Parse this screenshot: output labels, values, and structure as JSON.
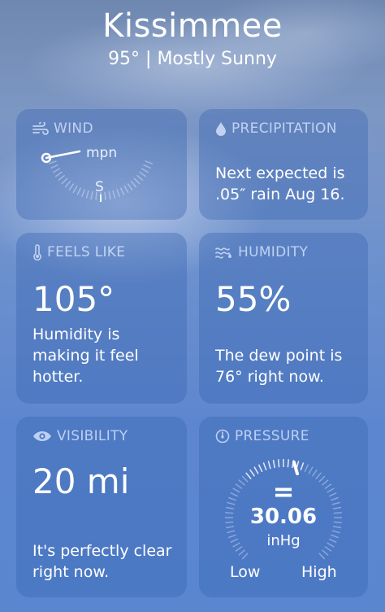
{
  "header": {
    "city": "Kissimmee",
    "summary": "95° | Mostly Sunny"
  },
  "wind": {
    "title": "WIND",
    "unit": "mpn",
    "direction": "S",
    "icon": "wind-icon"
  },
  "precipitation": {
    "title": "PRECIPITATION",
    "text": "Next expected is .05″ rain Aug 16.",
    "icon": "droplet-icon"
  },
  "feels_like": {
    "title": "FEELS LIKE",
    "value": "105°",
    "text": "Humidity is making it feel hotter.",
    "icon": "thermometer-icon"
  },
  "humidity": {
    "title": "HUMIDITY",
    "value": "55%",
    "text": "The dew point is 76° right now.",
    "icon": "humidity-icon"
  },
  "visibility": {
    "title": "VISIBILITY",
    "value": "20 mi",
    "text": "It's perfectly clear right now.",
    "icon": "eye-icon"
  },
  "pressure": {
    "title": "PRESSURE",
    "value": "30.06",
    "unit": "inHg",
    "low_label": "Low",
    "high_label": "High",
    "trend_symbol": "=",
    "icon": "gauge-icon"
  },
  "colors": {
    "card_bg": "#3764af",
    "title_text": "#dce8ff",
    "text": "#ffffff"
  }
}
